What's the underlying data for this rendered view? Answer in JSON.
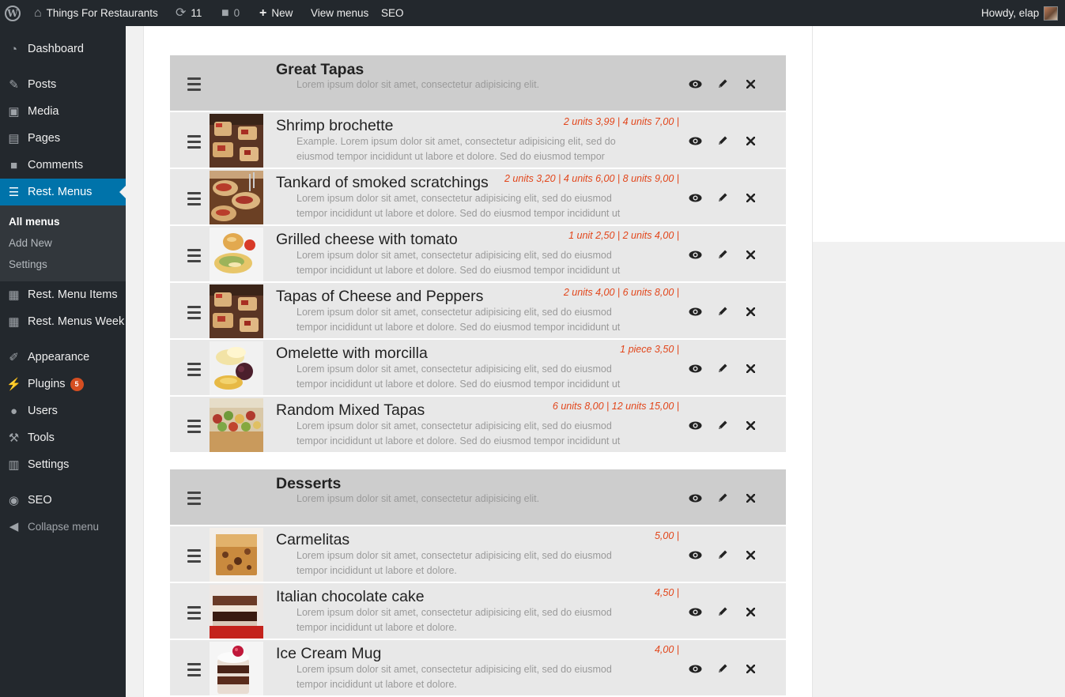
{
  "adminbar": {
    "site_name": "Things For Restaurants",
    "updates_count": "11",
    "comments_count": "0",
    "new_label": "New",
    "view_menus_label": "View menus",
    "seo_label": "SEO",
    "greeting": "Howdy, elap"
  },
  "sidebar": {
    "dashboard": "Dashboard",
    "posts": "Posts",
    "media": "Media",
    "pages": "Pages",
    "comments": "Comments",
    "rest_menus": "Rest. Menus",
    "sub_all_menus": "All menus",
    "sub_add_new": "Add New",
    "sub_settings": "Settings",
    "rest_menu_items": "Rest. Menu Items",
    "rest_menus_week": "Rest. Menus Week",
    "appearance": "Appearance",
    "plugins": "Plugins",
    "plugins_badge": "5",
    "users": "Users",
    "tools": "Tools",
    "settings": "Settings",
    "seo": "SEO",
    "collapse": "Collapse menu"
  },
  "categories": [
    {
      "title": "Great Tapas",
      "desc": "Lorem ipsum dolor sit amet, consectetur adipisicing elit.",
      "items": [
        {
          "title": "Shrimp brochette",
          "prices": "2 units 3,99 | 4 units 7,00 |",
          "desc1": "Example. Lorem ipsum dolor sit amet, consectetur adipisicing elit, sed do",
          "desc2": "eiusmod tempor incididunt ut labore et dolore. Sed do eiusmod tempor"
        },
        {
          "title": "Tankard of smoked scratchings",
          "prices": "2 units 3,20 | 4 units 6,00 | 8 units 9,00 |",
          "desc1": "Lorem ipsum dolor sit amet, consectetur adipisicing elit, sed do eiusmod",
          "desc2": "tempor incididunt ut labore et dolore. Sed do eiusmod tempor incididunt ut"
        },
        {
          "title": "Grilled cheese with tomato",
          "prices": "1 unit 2,50 | 2 units 4,00 |",
          "desc1": "Lorem ipsum dolor sit amet, consectetur adipisicing elit, sed do eiusmod",
          "desc2": "tempor incididunt ut labore et dolore. Sed do eiusmod tempor incididunt ut"
        },
        {
          "title": "Tapas of Cheese and Peppers",
          "prices": "2 units 4,00 | 6 units 8,00 |",
          "desc1": "Lorem ipsum dolor sit amet, consectetur adipisicing elit, sed do eiusmod",
          "desc2": "tempor incididunt ut labore et dolore. Sed do eiusmod tempor incididunt ut"
        },
        {
          "title": "Omelette with morcilla",
          "prices": "1 piece 3,50 |",
          "desc1": "Lorem ipsum dolor sit amet, consectetur adipisicing elit, sed do eiusmod",
          "desc2": "tempor incididunt ut labore et dolore. Sed do eiusmod tempor incididunt ut"
        },
        {
          "title": "Random Mixed Tapas",
          "prices": "6 units 8,00 | 12 units 15,00 |",
          "desc1": "Lorem ipsum dolor sit amet, consectetur adipisicing elit, sed do eiusmod",
          "desc2": "tempor incididunt ut labore et dolore. Sed do eiusmod tempor incididunt ut"
        }
      ]
    },
    {
      "title": "Desserts",
      "desc": "Lorem ipsum dolor sit amet, consectetur adipisicing elit.",
      "items": [
        {
          "title": "Carmelitas",
          "prices": "5,00 |",
          "desc1": "Lorem ipsum dolor sit amet, consectetur adipisicing elit, sed do eiusmod",
          "desc2": "tempor incididunt ut labore et dolore."
        },
        {
          "title": "Italian chocolate cake",
          "prices": "4,50 |",
          "desc1": "Lorem ipsum dolor sit amet, consectetur adipisicing elit, sed do eiusmod",
          "desc2": "tempor incididunt ut labore et dolore."
        },
        {
          "title": "Ice Cream Mug",
          "prices": "4,00 |",
          "desc1": "Lorem ipsum dolor sit amet, consectetur adipisicing elit, sed do eiusmod",
          "desc2": "tempor incididunt ut labore et dolore."
        }
      ]
    }
  ]
}
